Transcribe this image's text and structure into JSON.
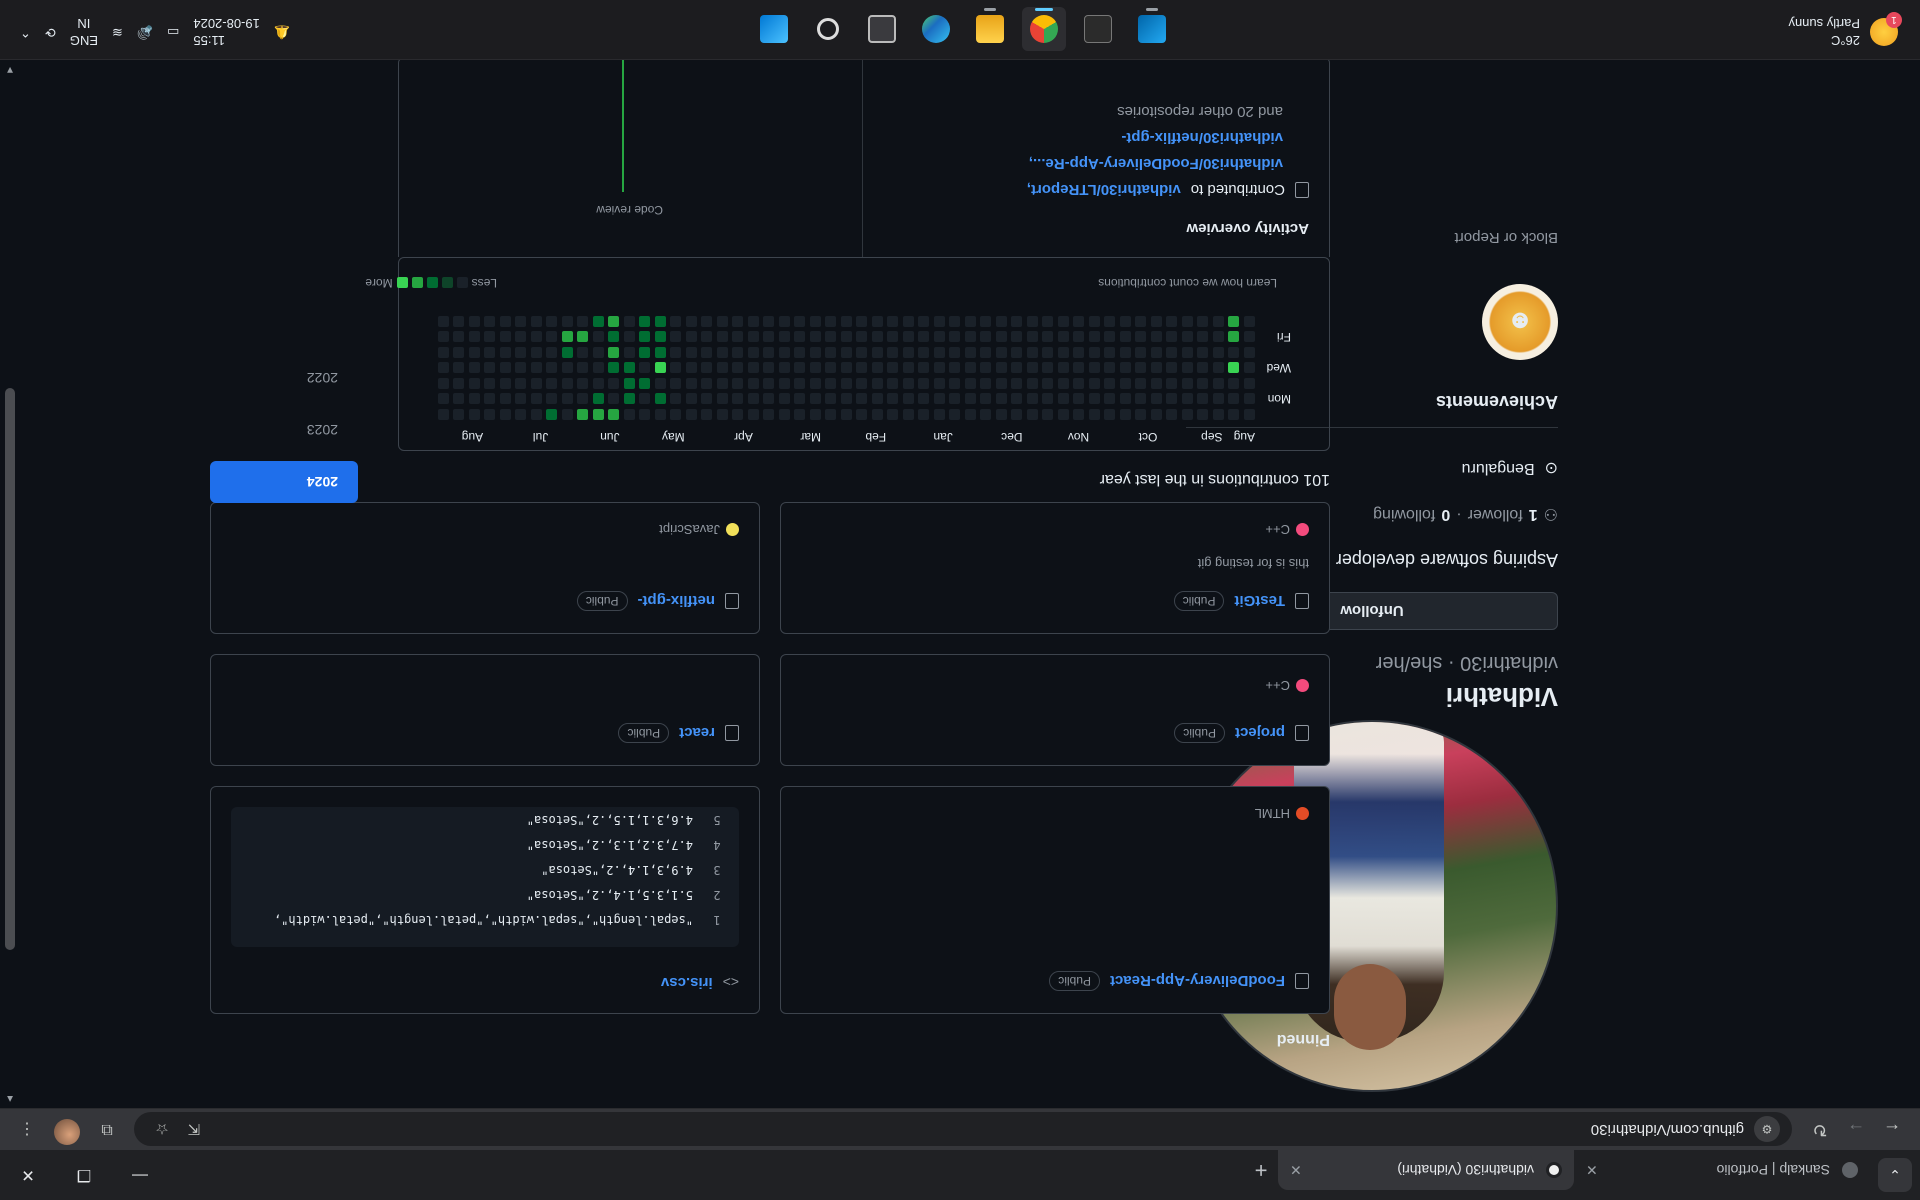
{
  "browser": {
    "tabs": [
      {
        "title": "Sankalp | Portfolio"
      },
      {
        "title": "vidhathri30 (Vidhathri)"
      }
    ],
    "url": "github.com/Vidhathri30"
  },
  "profile": {
    "name": "Vidhathri",
    "handle": "vidhathri30 · she/her",
    "unfollow_label": "Unfollow",
    "bio": "Aspiring software developer",
    "followers_count": "1",
    "followers_label": "follower",
    "separator": "·",
    "following_count": "0",
    "following_label": "following",
    "location": "Bengaluru",
    "achievements_title": "Achievements",
    "block_report": "Block or Report"
  },
  "pinned": {
    "title": "Pinned",
    "cards": [
      {
        "name": "FoodDelivery-App-React",
        "visibility": "Public",
        "language": "HTML",
        "lang_color": "#e34c26"
      },
      {
        "name": "iris.csv",
        "code_lines": [
          {
            "n": "1",
            "text": "\"sepal.length\",\"sepal.width\",\"petal.length\",\"petal.width\","
          },
          {
            "n": "2",
            "text": "5.1,3.5,1.4,.2,\"Setosa\""
          },
          {
            "n": "3",
            "text": "4.9,3,1.4,.2,\"Setosa\""
          },
          {
            "n": "4",
            "text": "4.7,3.2,1.3,.2,\"Setosa\""
          },
          {
            "n": "5",
            "text": "4.6,3.1,1.5,.2,\"Setosa\""
          }
        ]
      },
      {
        "name": "project",
        "visibility": "Public",
        "language": "C++",
        "lang_color": "#f34b7d"
      },
      {
        "name": "react",
        "visibility": "Public"
      },
      {
        "name": "TestGit",
        "visibility": "Public",
        "description": "this is for testing git",
        "language": "C++",
        "lang_color": "#f34b7d"
      },
      {
        "name": "netflix-gpt-",
        "visibility": "Public",
        "language": "JavaScript",
        "lang_color": "#f1e05a"
      }
    ]
  },
  "contributions": {
    "title": "101 contributions in the last year",
    "months": [
      "Aug",
      "Sep",
      "Oct",
      "Nov",
      "Dec",
      "Jan",
      "Feb",
      "Mar",
      "Apr",
      "May",
      "Jun",
      "Jul",
      "Aug"
    ],
    "days": [
      "Mon",
      "Wed",
      "Fri"
    ],
    "learn_link": "Learn how we count contributions",
    "less": "Less",
    "more": "More",
    "colors": [
      "#1a2129",
      "#0e4429",
      "#006d32",
      "#26a641",
      "#39d353"
    ],
    "active_cells": [
      [
        1,
        3,
        4
      ],
      [
        1,
        5,
        3
      ],
      [
        1,
        6,
        3
      ],
      [
        38,
        1,
        2
      ],
      [
        38,
        3,
        4
      ],
      [
        38,
        4,
        2
      ],
      [
        38,
        5,
        2
      ],
      [
        38,
        6,
        2
      ],
      [
        39,
        2,
        2
      ],
      [
        39,
        4,
        2
      ],
      [
        39,
        5,
        2
      ],
      [
        39,
        6,
        2
      ],
      [
        40,
        1,
        2
      ],
      [
        40,
        2,
        2
      ],
      [
        40,
        3,
        2
      ],
      [
        41,
        0,
        3
      ],
      [
        41,
        3,
        2
      ],
      [
        41,
        4,
        3
      ],
      [
        41,
        5,
        2
      ],
      [
        41,
        6,
        3
      ],
      [
        42,
        0,
        3
      ],
      [
        42,
        1,
        2
      ],
      [
        42,
        6,
        2
      ],
      [
        43,
        0,
        3
      ],
      [
        43,
        5,
        3
      ],
      [
        44,
        4,
        2
      ],
      [
        44,
        5,
        3
      ],
      [
        45,
        0,
        2
      ]
    ]
  },
  "activity": {
    "title": "Activity overview",
    "contributed_prefix": "Contributed to",
    "repos": [
      "vidhathri30/LTReport,",
      "vidhathri30/FoodDelivery-App-Re...,",
      "vidhathri30/netflix-gpt-"
    ],
    "more_text": "and 20 other repositories",
    "code_review": "Code review"
  },
  "years": [
    "2024",
    "2023",
    "2022"
  ],
  "taskbar": {
    "temperature": "26°C",
    "weather": "Partly sunny",
    "notif": "1",
    "lang_top": "ENG",
    "lang_bottom": "IN",
    "time": "11:55",
    "date": "19-08-2024"
  }
}
